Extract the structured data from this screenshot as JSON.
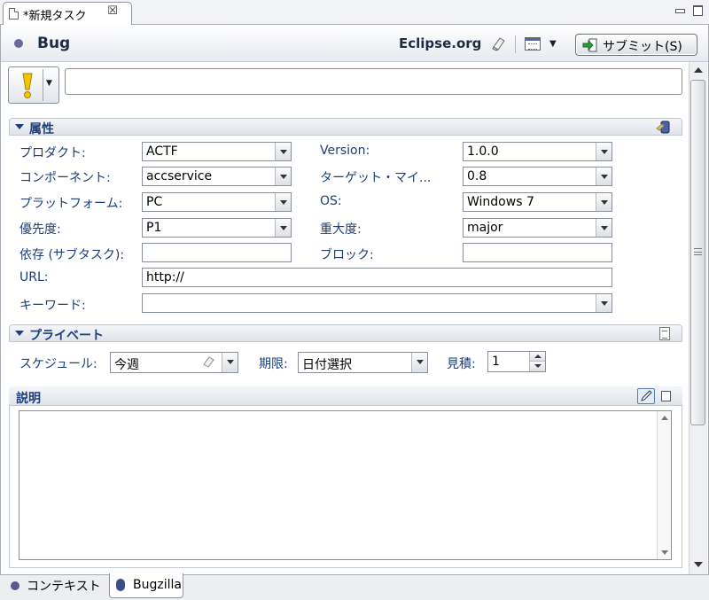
{
  "editor_tab": {
    "title": "*新規タスク",
    "close_glyph": "☒"
  },
  "header": {
    "task_title": "Bug",
    "repository": "Eclipse.org",
    "submit_label": "サブミット(S)"
  },
  "summary": {
    "value": ""
  },
  "attributes": {
    "section_title": "属性",
    "fields": [
      {
        "label": "プロダクト:",
        "value": "ACTF"
      },
      {
        "label": "Version:",
        "value": "1.0.0"
      },
      {
        "label": "コンポーネント:",
        "value": "accservice"
      },
      {
        "label": "ターゲット・マイ...",
        "value": "0.8"
      },
      {
        "label": "プラットフォーム:",
        "value": "PC"
      },
      {
        "label": "OS:",
        "value": "Windows 7"
      },
      {
        "label": "優先度:",
        "value": "P1"
      },
      {
        "label": "重大度:",
        "value": "major"
      },
      {
        "label": "依存 (サブタスク):",
        "value": ""
      },
      {
        "label": "ブロック:",
        "value": ""
      },
      {
        "label": "URL:",
        "value": "http://"
      },
      {
        "label": "キーワード:",
        "value": ""
      }
    ]
  },
  "private": {
    "section_title": "プライベート",
    "schedule_label": "スケジュール:",
    "schedule_value": "今週",
    "due_label": "期限:",
    "due_value": "日付選択",
    "estimate_label": "見積:",
    "estimate_value": "1"
  },
  "description": {
    "section_title": "説明",
    "value": ""
  },
  "bottom_tabs": [
    {
      "label": "コンテキスト"
    },
    {
      "label": "Bugzilla"
    }
  ],
  "colors": {
    "label": "#1c3e7a",
    "section_title": "#1c3e7a",
    "border": "#8a9099"
  },
  "icons": [
    "document-icon",
    "close-icon",
    "clear-icon",
    "calendar-icon",
    "submit-icon",
    "priority-exclamation-icon",
    "tool-icon",
    "notes-icon",
    "edit-icon",
    "preview-icon",
    "bugzilla-icon"
  ]
}
